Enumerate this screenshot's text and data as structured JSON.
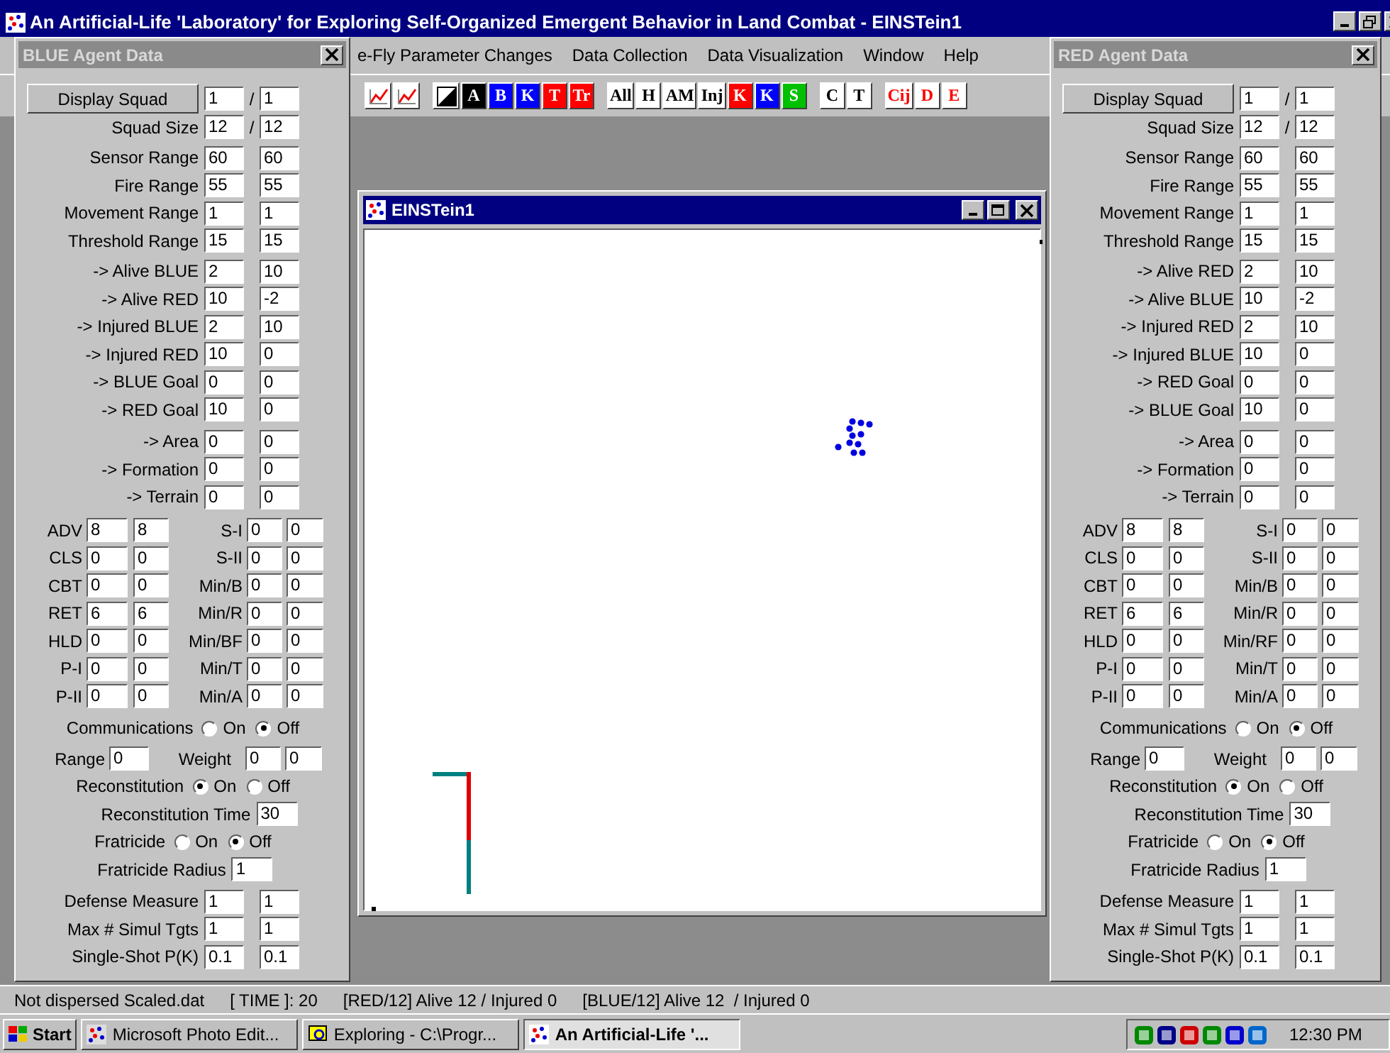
{
  "window": {
    "title": "An Artificial-Life 'Laboratory' for Exploring Self-Organized Emergent Behavior in Land Combat - EINSTein1"
  },
  "menu": [
    "e-Fly Parameter Changes",
    "Data Collection",
    "Data Visualization",
    "Window",
    "Help"
  ],
  "toolbar": [
    {
      "kind": "chart"
    },
    {
      "kind": "chart"
    },
    {
      "kind": "separator"
    },
    {
      "kind": "split"
    },
    {
      "kind": "filled",
      "label": "A",
      "color": "#000000"
    },
    {
      "kind": "filled",
      "label": "B",
      "color": "#0000ff"
    },
    {
      "kind": "filled",
      "label": "K",
      "color": "#0000ff"
    },
    {
      "kind": "filled",
      "label": "T",
      "color": "#ff0000"
    },
    {
      "kind": "filled",
      "label": "Tr",
      "color": "#ff0000"
    },
    {
      "kind": "separator"
    },
    {
      "kind": "outlined",
      "label": "All",
      "color": "#000000"
    },
    {
      "kind": "outlined",
      "label": "H",
      "color": "#000000"
    },
    {
      "kind": "outlined",
      "label": "AM",
      "color": "#000000"
    },
    {
      "kind": "outlined",
      "label": "Inj",
      "color": "#000000"
    },
    {
      "kind": "filled",
      "label": "K",
      "color": "#ff0000"
    },
    {
      "kind": "filled",
      "label": "K",
      "color": "#0000ff"
    },
    {
      "kind": "filled",
      "label": "S",
      "color": "#00c000"
    },
    {
      "kind": "separator"
    },
    {
      "kind": "outlined",
      "label": "C",
      "color": "#000000"
    },
    {
      "kind": "outlined",
      "label": "T",
      "color": "#000000"
    },
    {
      "kind": "separator"
    },
    {
      "kind": "outlined",
      "label": "Cij",
      "color": "#ff0000"
    },
    {
      "kind": "outlined",
      "label": "D",
      "color": "#ff0000"
    },
    {
      "kind": "outlined",
      "label": "E",
      "color": "#ff0000"
    }
  ],
  "panels": [
    {
      "title": "BLUE Agent Data",
      "display": {
        "button": "Display Squad",
        "values": [
          "1",
          "1"
        ],
        "divider": "/"
      },
      "squad_size": {
        "label": "Squad Size",
        "values": [
          "12",
          "12"
        ],
        "divider": "/"
      },
      "ranges": [
        {
          "label": "Sensor Range",
          "values": [
            "60",
            "60"
          ]
        },
        {
          "label": "Fire Range",
          "values": [
            "55",
            "55"
          ]
        },
        {
          "label": "Movement Range",
          "values": [
            "1",
            "1"
          ]
        },
        {
          "label": "Threshold Range",
          "values": [
            "15",
            "15"
          ]
        }
      ],
      "weights": [
        {
          "label": "-> Alive BLUE",
          "values": [
            "2",
            "10"
          ]
        },
        {
          "label": "-> Alive RED",
          "values": [
            "10",
            "-2"
          ]
        },
        {
          "label": "-> Injured BLUE",
          "values": [
            "2",
            "10"
          ]
        },
        {
          "label": "-> Injured RED",
          "values": [
            "10",
            "0"
          ]
        },
        {
          "label": "-> BLUE Goal",
          "values": [
            "0",
            "0"
          ]
        },
        {
          "label": "-> RED Goal",
          "values": [
            "10",
            "0"
          ]
        }
      ],
      "other_weights": [
        {
          "label": "-> Area",
          "values": [
            "0",
            "0"
          ]
        },
        {
          "label": "-> Formation",
          "values": [
            "0",
            "0"
          ]
        },
        {
          "label": "-> Terrain",
          "values": [
            "0",
            "0"
          ]
        }
      ],
      "parameters": [
        {
          "left": {
            "label": "ADV",
            "values": [
              "8",
              "8"
            ]
          },
          "right": {
            "label": "S-I",
            "values": [
              "0",
              "0"
            ]
          }
        },
        {
          "left": {
            "label": "CLS",
            "values": [
              "0",
              "0"
            ]
          },
          "right": {
            "label": "S-II",
            "values": [
              "0",
              "0"
            ]
          }
        },
        {
          "left": {
            "label": "CBT",
            "values": [
              "0",
              "0"
            ]
          },
          "right": {
            "label": "Min/B",
            "values": [
              "0",
              "0"
            ]
          }
        },
        {
          "left": {
            "label": "RET",
            "values": [
              "6",
              "6"
            ]
          },
          "right": {
            "label": "Min/R",
            "values": [
              "0",
              "0"
            ]
          }
        },
        {
          "left": {
            "label": "HLD",
            "values": [
              "0",
              "0"
            ]
          },
          "right": {
            "label": "Min/BF",
            "values": [
              "0",
              "0"
            ]
          }
        },
        {
          "left": {
            "label": "P-I",
            "values": [
              "0",
              "0"
            ]
          },
          "right": {
            "label": "Min/T",
            "values": [
              "0",
              "0"
            ]
          }
        },
        {
          "left": {
            "label": "P-II",
            "values": [
              "0",
              "0"
            ]
          },
          "right": {
            "label": "Min/A",
            "values": [
              "0",
              "0"
            ]
          }
        }
      ],
      "communications": {
        "label": "Communications",
        "options": [
          {
            "label": "On",
            "selected": false
          },
          {
            "label": "Off",
            "selected": true
          }
        ]
      },
      "range_weight": {
        "range_label": "Range",
        "range_value": "0",
        "weight_label": "Weight",
        "weight_values": [
          "0",
          "0"
        ]
      },
      "reconstitution": {
        "label": "Reconstitution",
        "options": [
          {
            "label": "On",
            "selected": true
          },
          {
            "label": "Off",
            "selected": false
          }
        ]
      },
      "reconstitution_time": {
        "label": "Reconstitution Time",
        "value": "30"
      },
      "fratricide": {
        "label": "Fratricide",
        "options": [
          {
            "label": "On",
            "selected": false
          },
          {
            "label": "Off",
            "selected": true
          }
        ]
      },
      "fratricide_radius": {
        "label": "Fratricide Radius",
        "value": "1"
      },
      "combat": [
        {
          "label": "Defense Measure",
          "values": [
            "1",
            "1"
          ]
        },
        {
          "label": "Max # Simul Tgts",
          "values": [
            "1",
            "1"
          ]
        },
        {
          "label": "Single-Shot P(K)",
          "values": [
            "0.1",
            "0.1"
          ]
        }
      ]
    },
    {
      "title": "RED Agent Data",
      "display": {
        "button": "Display Squad",
        "values": [
          "1",
          "1"
        ],
        "divider": "/"
      },
      "squad_size": {
        "label": "Squad Size",
        "values": [
          "12",
          "12"
        ],
        "divider": "/"
      },
      "ranges": [
        {
          "label": "Sensor Range",
          "values": [
            "60",
            "60"
          ]
        },
        {
          "label": "Fire Range",
          "values": [
            "55",
            "55"
          ]
        },
        {
          "label": "Movement Range",
          "values": [
            "1",
            "1"
          ]
        },
        {
          "label": "Threshold Range",
          "values": [
            "15",
            "15"
          ]
        }
      ],
      "weights": [
        {
          "label": "-> Alive RED",
          "values": [
            "2",
            "10"
          ]
        },
        {
          "label": "-> Alive BLUE",
          "values": [
            "10",
            "-2"
          ]
        },
        {
          "label": "-> Injured RED",
          "values": [
            "2",
            "10"
          ]
        },
        {
          "label": "-> Injured BLUE",
          "values": [
            "10",
            "0"
          ]
        },
        {
          "label": "-> RED Goal",
          "values": [
            "0",
            "0"
          ]
        },
        {
          "label": "-> BLUE Goal",
          "values": [
            "10",
            "0"
          ]
        }
      ],
      "other_weights": [
        {
          "label": "-> Area",
          "values": [
            "0",
            "0"
          ]
        },
        {
          "label": "-> Formation",
          "values": [
            "0",
            "0"
          ]
        },
        {
          "label": "-> Terrain",
          "values": [
            "0",
            "0"
          ]
        }
      ],
      "parameters": [
        {
          "left": {
            "label": "ADV",
            "values": [
              "8",
              "8"
            ]
          },
          "right": {
            "label": "S-I",
            "values": [
              "0",
              "0"
            ]
          }
        },
        {
          "left": {
            "label": "CLS",
            "values": [
              "0",
              "0"
            ]
          },
          "right": {
            "label": "S-II",
            "values": [
              "0",
              "0"
            ]
          }
        },
        {
          "left": {
            "label": "CBT",
            "values": [
              "0",
              "0"
            ]
          },
          "right": {
            "label": "Min/B",
            "values": [
              "0",
              "0"
            ]
          }
        },
        {
          "left": {
            "label": "RET",
            "values": [
              "6",
              "6"
            ]
          },
          "right": {
            "label": "Min/R",
            "values": [
              "0",
              "0"
            ]
          }
        },
        {
          "left": {
            "label": "HLD",
            "values": [
              "0",
              "0"
            ]
          },
          "right": {
            "label": "Min/RF",
            "values": [
              "0",
              "0"
            ]
          }
        },
        {
          "left": {
            "label": "P-I",
            "values": [
              "0",
              "0"
            ]
          },
          "right": {
            "label": "Min/T",
            "values": [
              "0",
              "0"
            ]
          }
        },
        {
          "left": {
            "label": "P-II",
            "values": [
              "0",
              "0"
            ]
          },
          "right": {
            "label": "Min/A",
            "values": [
              "0",
              "0"
            ]
          }
        }
      ],
      "communications": {
        "label": "Communications",
        "options": [
          {
            "label": "On",
            "selected": false
          },
          {
            "label": "Off",
            "selected": true
          }
        ]
      },
      "range_weight": {
        "range_label": "Range",
        "range_value": "0",
        "weight_label": "Weight",
        "weight_values": [
          "0",
          "0"
        ]
      },
      "reconstitution": {
        "label": "Reconstitution",
        "options": [
          {
            "label": "On",
            "selected": true
          },
          {
            "label": "Off",
            "selected": false
          }
        ]
      },
      "reconstitution_time": {
        "label": "Reconstitution Time",
        "value": "30"
      },
      "fratricide": {
        "label": "Fratricide",
        "options": [
          {
            "label": "On",
            "selected": false
          },
          {
            "label": "Off",
            "selected": true
          }
        ]
      },
      "fratricide_radius": {
        "label": "Fratricide Radius",
        "value": "1"
      },
      "combat": [
        {
          "label": "Defense Measure",
          "values": [
            "1",
            "1"
          ]
        },
        {
          "label": "Max # Simul Tgts",
          "values": [
            "1",
            "1"
          ]
        },
        {
          "label": "Single-Shot P(K)",
          "values": [
            "0.1",
            "0.1"
          ]
        }
      ]
    }
  ],
  "child_window": {
    "title": "EINSTein1"
  },
  "status_bar": [
    "Not dispersed Scaled.dat",
    "[ TIME ]: 20",
    "[RED/12] Alive 12 / Injured 0",
    "[BLUE/12] Alive 12  / Injured 0"
  ],
  "taskbar": {
    "start": "Start",
    "tasks": [
      {
        "label": "Microsoft Photo Edit...",
        "selected": false
      },
      {
        "label": "Exploring - C:\\Progr...",
        "selected": false
      },
      {
        "label": "An Artificial-Life '...",
        "selected": true
      }
    ],
    "clock": "12:30 PM"
  }
}
